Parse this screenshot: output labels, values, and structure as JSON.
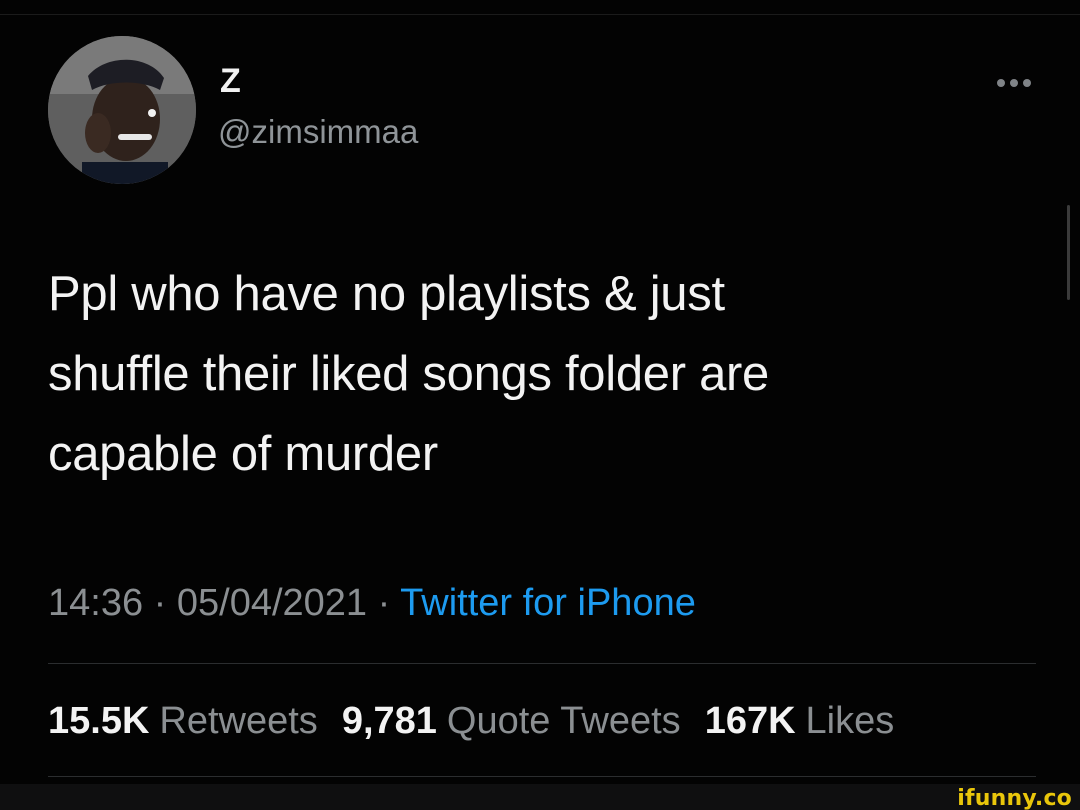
{
  "header": {
    "display_name": "Z",
    "handle": "@zimsimmaa",
    "more_icon": "more-horizontal-icon"
  },
  "tweet": {
    "text": "Ppl who have no playlists & just\nshuffle their liked songs folder are\ncapable of murder"
  },
  "meta": {
    "time": "14:36",
    "separator_1": " · ",
    "date": "05/04/2021",
    "separator_2": " · ",
    "source": "Twitter for iPhone"
  },
  "stats": {
    "retweets_value": "15.5K",
    "retweets_label": "Retweets",
    "quote_tweets_value": "9,781",
    "quote_tweets_label": "Quote Tweets",
    "likes_value": "167K",
    "likes_label": "Likes"
  },
  "watermark": {
    "text": "ifunny.co"
  },
  "colors": {
    "background": "#030303",
    "text_primary": "#f3f3f3",
    "text_secondary": "#8b8f92",
    "accent": "#1d9bf0",
    "watermark": "#e9c60b"
  }
}
